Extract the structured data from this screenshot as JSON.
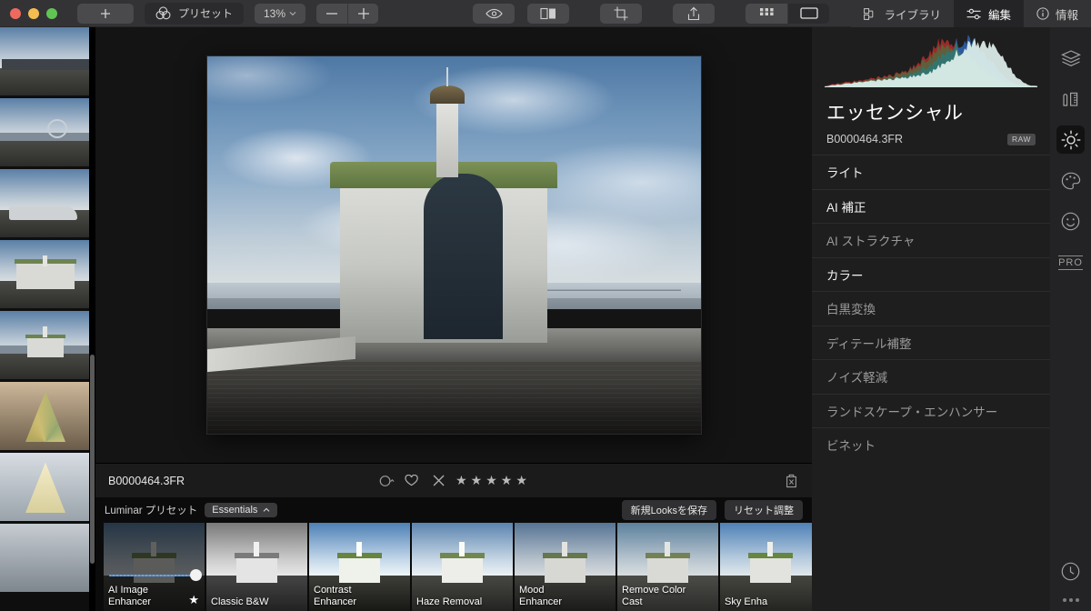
{
  "titlebar": {
    "traffic_lights": [
      "close",
      "minimize",
      "zoom"
    ],
    "add_label": "+",
    "presets_label": "プリセット",
    "zoom_value": "13%",
    "zoom_out_label": "–",
    "zoom_in_label": "+",
    "icons": [
      "eye-icon",
      "compare-icon",
      "crop-icon",
      "share-icon",
      "grid-view-icon",
      "single-view-icon"
    ],
    "tabs": [
      {
        "label": "ライブラリ",
        "icon": "library-icon",
        "active": false
      },
      {
        "label": "編集",
        "icon": "sliders-icon",
        "active": true
      },
      {
        "label": "情報",
        "icon": "info-icon",
        "active": false
      }
    ]
  },
  "filmstrip": {
    "items": [
      {
        "name": "waterfront-pier-wide",
        "selected": false
      },
      {
        "name": "minatomirai-ferris-wheel",
        "selected": false
      },
      {
        "name": "moored-boat",
        "selected": false
      },
      {
        "name": "pier-building-closeup",
        "selected": false
      },
      {
        "name": "pier-building-sky",
        "selected": true
      },
      {
        "name": "christmas-tree-atrium",
        "selected": false
      },
      {
        "name": "christmas-tree-white",
        "selected": false
      },
      {
        "name": "atrium-lower",
        "selected": false
      }
    ]
  },
  "canvas": {
    "image_name": "B0000464.3FR"
  },
  "infobar": {
    "filename": "B0000464.3FR",
    "color_label_icon": "color-label-icon",
    "favorite_icon": "heart-icon",
    "reject_icon": "reject-x-icon",
    "stars": [
      "★",
      "★",
      "★",
      "★",
      "★"
    ],
    "trash_icon": "trash-icon"
  },
  "preset_header": {
    "title": "Luminar プリセット",
    "collection": "Essentials",
    "collection_chevron": "chevron-up-icon",
    "save_looks_label": "新規Looksを保存",
    "reset_label": "リセット調整"
  },
  "presets": [
    {
      "label": "AI Image\nEnhancer",
      "label_line1": "AI Image",
      "label_line2": "Enhancer",
      "selected": true,
      "has_slider": true,
      "starred": true
    },
    {
      "label": "Classic B&W",
      "label_line1": "Classic B&W",
      "label_line2": "",
      "selected": false,
      "has_slider": false,
      "starred": false
    },
    {
      "label": "Contrast Enhancer",
      "label_line1": "Contrast",
      "label_line2": "Enhancer",
      "selected": false,
      "has_slider": false,
      "starred": false
    },
    {
      "label": "Haze Removal",
      "label_line1": "Haze Removal",
      "label_line2": "",
      "selected": false,
      "has_slider": false,
      "starred": false
    },
    {
      "label": "Mood Enhancer",
      "label_line1": "Mood",
      "label_line2": "Enhancer",
      "selected": false,
      "has_slider": false,
      "starred": false
    },
    {
      "label": "Remove Color Cast",
      "label_line1": "Remove Color",
      "label_line2": "Cast",
      "selected": false,
      "has_slider": false,
      "starred": false
    },
    {
      "label": "Sky Enhancer",
      "label_line1": "Sky Enha",
      "label_line2": "",
      "selected": false,
      "has_slider": false,
      "starred": false
    }
  ],
  "right_panel": {
    "histogram_name": "rgb-histogram",
    "title": "エッセンシャル",
    "filename": "B0000464.3FR",
    "format_badge": "RAW",
    "items": [
      {
        "label": "ライト",
        "bright": true
      },
      {
        "label": "AI 補正",
        "bright": true
      },
      {
        "label": "AI ストラクチャ",
        "bright": false
      },
      {
        "label": "カラー",
        "bright": true
      },
      {
        "label": "白黒変換",
        "bright": false
      },
      {
        "label": "ディテール補整",
        "bright": false
      },
      {
        "label": "ノイズ軽減",
        "bright": false
      },
      {
        "label": "ランドスケープ・エンハンサー",
        "bright": false
      },
      {
        "label": "ビネット",
        "bright": false
      }
    ]
  },
  "rail": {
    "icons": [
      {
        "name": "layers-icon",
        "active": false
      },
      {
        "name": "tools-icon",
        "active": false
      },
      {
        "name": "sun-essentials-icon",
        "active": true
      },
      {
        "name": "palette-creative-icon",
        "active": false
      },
      {
        "name": "portrait-face-icon",
        "active": false
      },
      {
        "name": "pro-icon",
        "active": false,
        "label": "PRO"
      },
      {
        "name": "history-clock-icon",
        "active": false
      },
      {
        "name": "more-dots-icon",
        "active": false
      }
    ]
  },
  "colors": {
    "titlebar_bg": "#333335",
    "panel_bg": "#1e1e1e",
    "canvas_bg": "#141414",
    "rail_bg": "#232325",
    "selection_amber": "#e0a53a",
    "slider_blue": "#4e8fd8",
    "text_primary": "#f2f2f2",
    "text_dim": "#9a9a9a"
  },
  "chart_data": {
    "type": "area",
    "title": "RGB Histogram",
    "xlabel": "",
    "ylabel": "",
    "grid": false,
    "legend": "none",
    "x": [
      0,
      4,
      8,
      12,
      16,
      20,
      24,
      28,
      32,
      36,
      40,
      44,
      48,
      52,
      56,
      60,
      64,
      68,
      72,
      76,
      80,
      84,
      88,
      92,
      96,
      100
    ],
    "series": [
      {
        "name": "luminance",
        "color": "#dff0ec",
        "values": [
          2,
          4,
          6,
          8,
          10,
          12,
          13,
          15,
          16,
          18,
          20,
          23,
          27,
          33,
          42,
          54,
          68,
          80,
          88,
          92,
          86,
          70,
          48,
          26,
          10,
          3
        ]
      },
      {
        "name": "red",
        "color": "#a32a2a",
        "values": [
          3,
          6,
          9,
          11,
          13,
          16,
          18,
          21,
          24,
          28,
          34,
          44,
          58,
          76,
          90,
          96,
          88,
          70,
          50,
          34,
          22,
          14,
          9,
          6,
          4,
          2
        ]
      },
      {
        "name": "green",
        "color": "#2f8a4a",
        "values": [
          2,
          4,
          7,
          9,
          11,
          14,
          16,
          19,
          22,
          26,
          32,
          40,
          52,
          66,
          80,
          86,
          82,
          72,
          58,
          44,
          30,
          20,
          12,
          7,
          4,
          2
        ]
      },
      {
        "name": "blue",
        "color": "#2f5fa8",
        "values": [
          2,
          3,
          5,
          7,
          9,
          11,
          13,
          15,
          17,
          20,
          24,
          30,
          38,
          48,
          60,
          74,
          88,
          96,
          92,
          76,
          54,
          34,
          18,
          9,
          4,
          2
        ]
      }
    ],
    "ylim": [
      0,
      100
    ]
  }
}
